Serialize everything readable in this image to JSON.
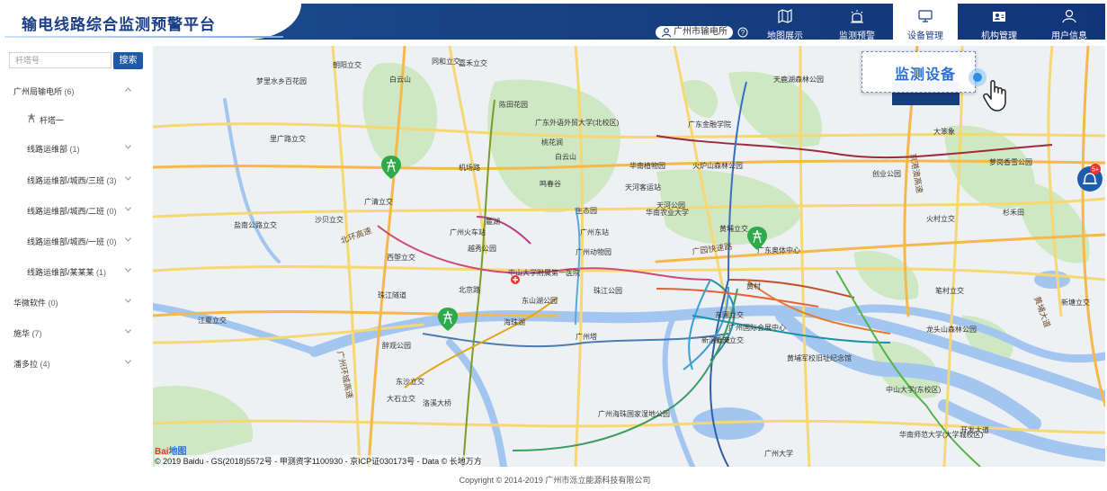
{
  "header": {
    "app_title": "输电线路综合监测预警平台",
    "org_name": "广州市输电所",
    "nav": [
      {
        "label": "地图展示",
        "icon": "map-icon"
      },
      {
        "label": "监测预警",
        "icon": "alarm-icon"
      },
      {
        "label": "设备管理",
        "icon": "monitor-icon",
        "active": true
      },
      {
        "label": "机构管理",
        "icon": "org-icon"
      },
      {
        "label": "用户信息",
        "icon": "user-icon"
      }
    ]
  },
  "sidebar": {
    "search_placeholder": "杆塔号",
    "search_button": "搜索",
    "tree": [
      {
        "label": "广州局输电所",
        "count": "(6)",
        "expanded": true
      },
      {
        "label": "杆塔一",
        "count": ""
      },
      {
        "label": "线路运维部",
        "count": "(1)"
      },
      {
        "label": "线路运维部/城西/三班",
        "count": "(3)"
      },
      {
        "label": "线路运维部/城西/二班",
        "count": "(0)"
      },
      {
        "label": "线路运维部/城西/一班",
        "count": "(0)"
      },
      {
        "label": "线路运维部/某某某",
        "count": "(1)"
      },
      {
        "label": "华微软件",
        "count": "(0)"
      },
      {
        "label": "施华",
        "count": "(7)"
      },
      {
        "label": "潘多拉",
        "count": "(4)"
      }
    ]
  },
  "map": {
    "places": [
      "白云山",
      "嘉禾立交",
      "同和立交",
      "朝阳立交",
      "梦里水乡百花园",
      "陈田花园",
      "广东外语外贸大学(北校区)",
      "桃花涧",
      "白云山",
      "鸣春谷",
      "机场路",
      "广州火车站",
      "麓湖",
      "越秀公园",
      "中山大学附属第一医院",
      "东山湖公园",
      "北京路",
      "广州塔",
      "海珠湖",
      "天河客运站",
      "华南植物园",
      "华南农业大学",
      "火炉山森林公园",
      "广东金融学院",
      "天鹿湖森林公园",
      "广州东站",
      "广州动物园",
      "珠江公园",
      "广东奥体中心",
      "黄埔立交",
      "黄村",
      "东圃立交",
      "新滘立交",
      "新洲立交",
      "龙头山森林公园",
      "中山大学(东校区)",
      "华南师范大学(大学城校区)",
      "广州大学",
      "黄埔军校旧址纪念馆",
      "开发大道",
      "杉禾田",
      "笔村立交",
      "新塘立交",
      "创业公园",
      "萝岗香雪公园",
      "大笨象",
      "火村立交",
      "里广路立交",
      "广清立交",
      "沙贝立交",
      "盐南公路立交",
      "西塱立交",
      "珠江隧道",
      "江夏立交",
      "醉观公园",
      "东沙立交",
      "大石立交",
      "洛溪大桥",
      "广州国际会展中心",
      "广州海珠国家湿地公园",
      "生态园",
      "天河公园"
    ],
    "road_labels": [
      "广园快速路",
      "京港澳高速",
      "黄埔大道",
      "广州环城高速",
      "北环高速"
    ],
    "alert_badge": "5+",
    "callout_text": "监测设备",
    "copyright_map": "© 2019 Baidu - GS(2018)5572号 - 甲测资字1100930 - 京ICP证030173号 - Data © 长地万方",
    "logo_a": "Bai",
    "logo_b": "地图"
  },
  "footer": {
    "text": "Copyright © 2014-2019 广州市泺立能源科技有限公司"
  }
}
